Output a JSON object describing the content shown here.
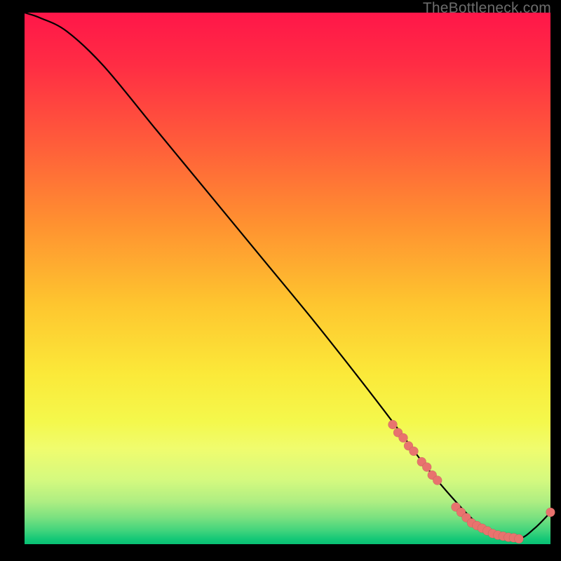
{
  "watermark": "TheBottleneck.com",
  "chart_data": {
    "type": "line",
    "title": "",
    "xlabel": "",
    "ylabel": "",
    "xlim": [
      0,
      100
    ],
    "ylim": [
      0,
      100
    ],
    "grid": false,
    "gradient_bg": "red-yellow-green-vertical",
    "series": [
      {
        "name": "curve",
        "style": "line",
        "x": [
          0,
          3,
          8,
          15,
          25,
          35,
          45,
          55,
          63,
          70,
          76,
          82,
          86,
          90,
          94,
          97,
          100
        ],
        "y": [
          100,
          99,
          96.5,
          90,
          78,
          66,
          54,
          42,
          32,
          23,
          15,
          8,
          4,
          1.5,
          1,
          3,
          6
        ]
      },
      {
        "name": "markers",
        "style": "scatter",
        "x": [
          70,
          71,
          72,
          73,
          74,
          75.5,
          76.5,
          77.5,
          78.5,
          82,
          83,
          84,
          85,
          86,
          87,
          88,
          89,
          90,
          91,
          92,
          93,
          94,
          100
        ],
        "y": [
          22.5,
          21,
          20,
          18.5,
          17.5,
          15.5,
          14.5,
          13,
          12,
          7,
          6,
          5,
          4,
          3.5,
          3,
          2.5,
          2,
          1.7,
          1.5,
          1.3,
          1.2,
          1,
          6
        ]
      }
    ]
  }
}
